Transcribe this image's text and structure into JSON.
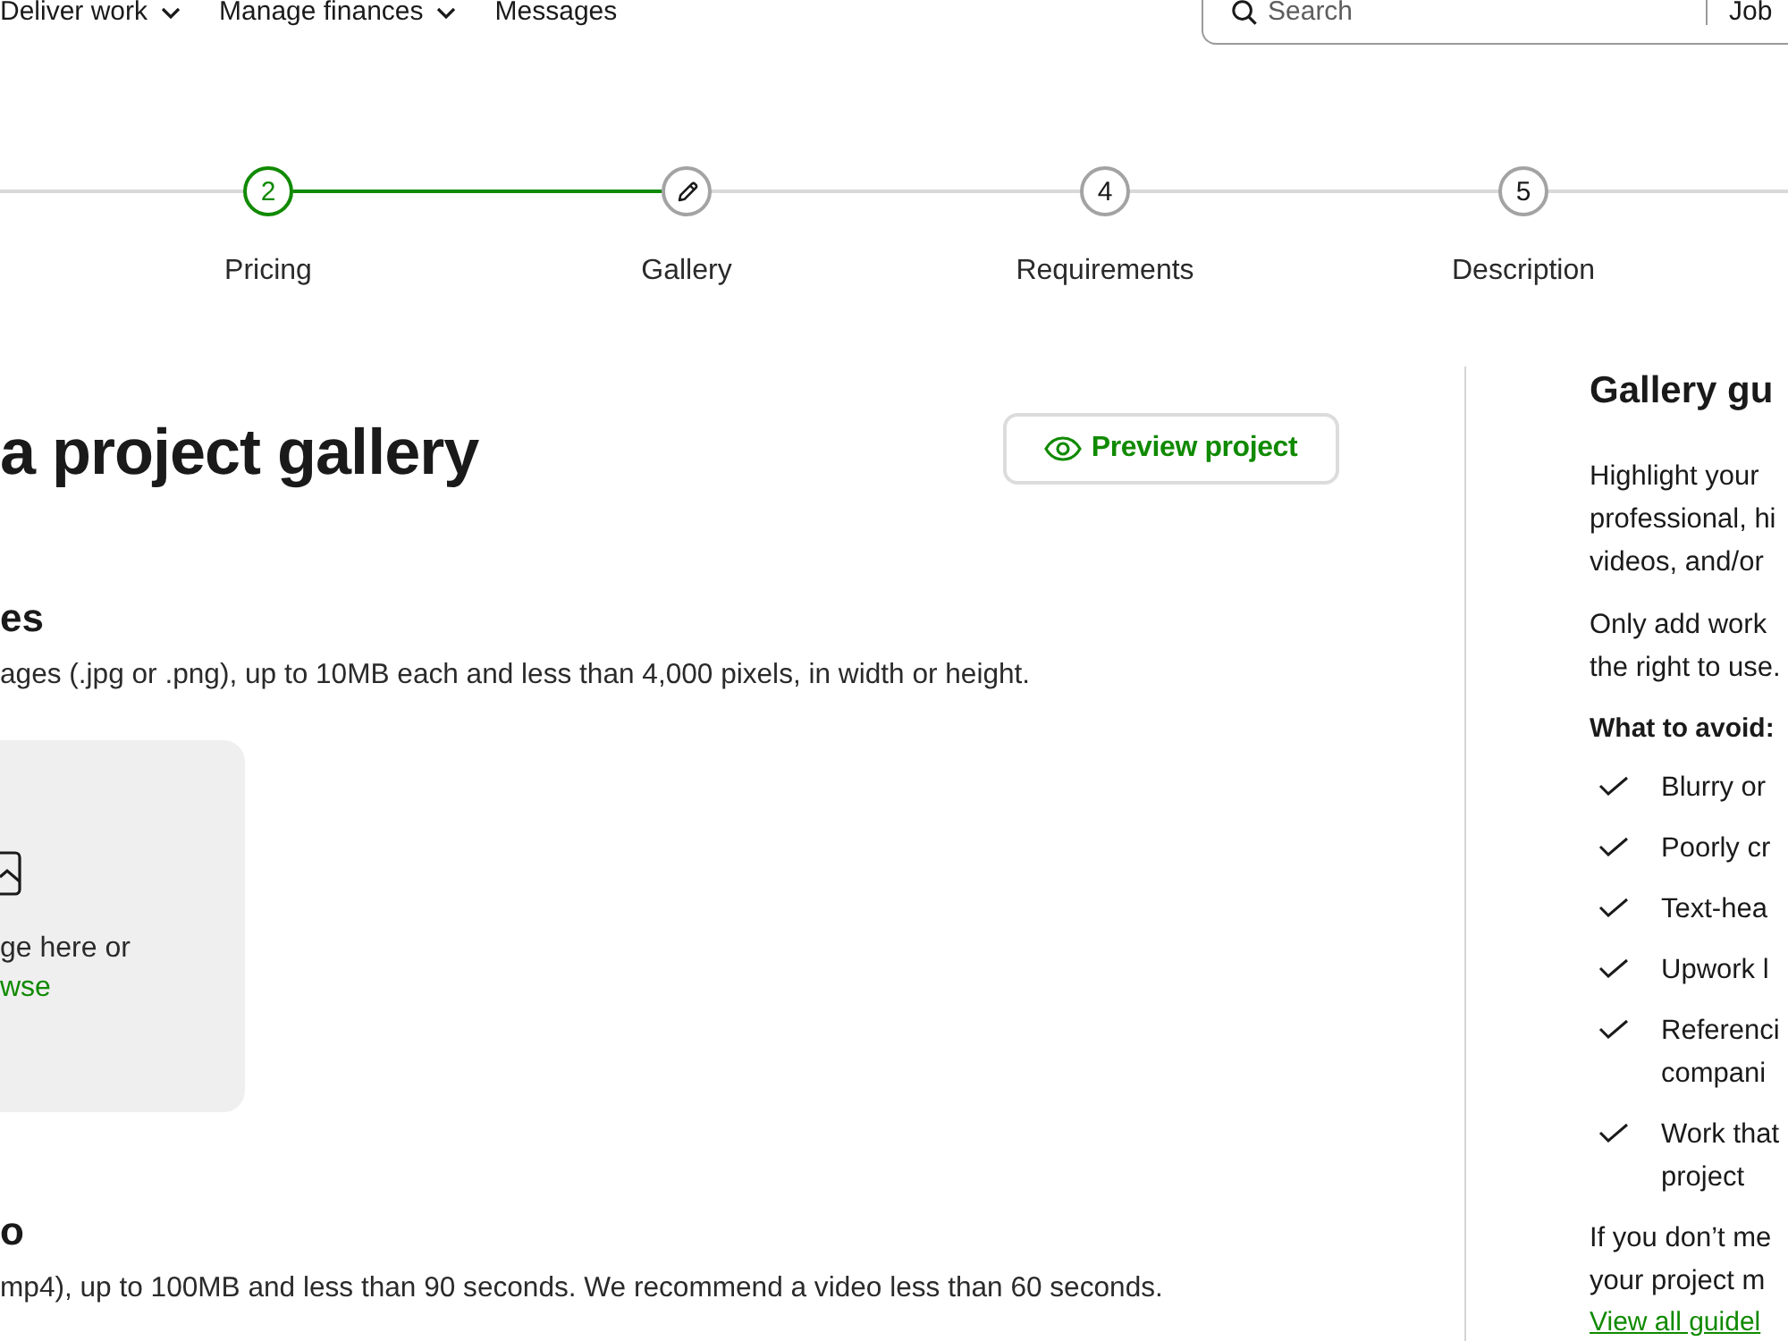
{
  "nav": {
    "items": [
      {
        "label": "Deliver work",
        "dropdown": true
      },
      {
        "label": "Manage finances",
        "dropdown": true
      },
      {
        "label": "Messages",
        "dropdown": false
      }
    ],
    "search": {
      "placeholder": "Search",
      "category": "Job"
    }
  },
  "stepper": {
    "steps": [
      {
        "number": "2",
        "label": "Pricing",
        "completed": true,
        "selected": false
      },
      {
        "label": "Gallery",
        "completed": false,
        "selected": true
      },
      {
        "number": "4",
        "label": "Requirements",
        "completed": false,
        "selected": false
      },
      {
        "number": "5",
        "label": "Description",
        "completed": false,
        "selected": false
      }
    ]
  },
  "main": {
    "title": "a project gallery",
    "preview_button": "Preview project",
    "sections": [
      {
        "heading": "es",
        "description": "ages (.jpg or .png), up to 10MB each and less than 4,000 pixels, in width or height.",
        "dropzone": {
          "text": "ge here or",
          "link": "wse"
        }
      },
      {
        "heading": "o",
        "description": "mp4), up to 100MB and less than 90 seconds. We recommend a video less than 60 seconds."
      }
    ]
  },
  "sidebar": {
    "title": "Gallery gu",
    "paragraphs": [
      [
        "Highlight your",
        "professional, hi",
        "videos, and/or"
      ],
      [
        "Only add work",
        "the right to use."
      ]
    ],
    "avoid_heading": "What to avoid:",
    "avoid_items": [
      [
        "Blurry or"
      ],
      [
        "Poorly cr"
      ],
      [
        "Text-hea"
      ],
      [
        "Upwork l"
      ],
      [
        "Referenci",
        "compani"
      ],
      [
        "Work that",
        "project"
      ]
    ],
    "note": [
      "If you don’t me",
      "your project m"
    ],
    "link": "View all guidel"
  }
}
